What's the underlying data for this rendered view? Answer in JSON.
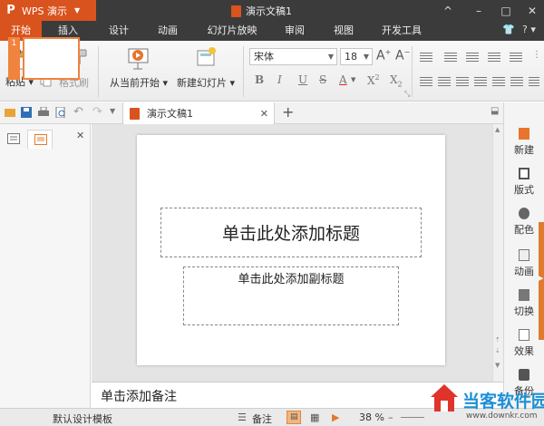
{
  "titlebar": {
    "app_logo": "P",
    "app_name": "WPS 演示",
    "doc_title": "演示文稿1",
    "controls": [
      "^",
      "–",
      "□",
      "✕"
    ]
  },
  "menu": {
    "tabs": [
      "开始",
      "插入",
      "设计",
      "动画",
      "幻灯片放映",
      "审阅",
      "视图",
      "开发工具"
    ],
    "active_tab": "开始",
    "help": "?"
  },
  "ribbon": {
    "paste": "粘贴",
    "format_painter": "格式刷",
    "from_current": "从当前开始",
    "new_slide": "新建幻灯片",
    "font_name": "宋体",
    "font_size": "18",
    "fmt_bold": "B",
    "fmt_italic": "I",
    "fmt_underline": "U",
    "fmt_strike": "S",
    "fmt_color": "A",
    "fmt_super": "X",
    "fmt_sub": "X"
  },
  "quickaccess": {
    "doc_tab_title": "演示文稿1",
    "add_tab": "+"
  },
  "slide": {
    "title_placeholder": "单击此处添加标题",
    "subtitle_placeholder": "单击此处添加副标题",
    "thumb_number": "1"
  },
  "notes": {
    "placeholder": "单击添加备注"
  },
  "rightpane": {
    "items": [
      "新建",
      "版式",
      "配色",
      "动画",
      "切换",
      "效果",
      "备份"
    ]
  },
  "statusbar": {
    "template": "默认设计模板",
    "notes_label": "备注",
    "zoom": "38 %"
  },
  "watermark": {
    "name": "当客软件园",
    "url": "www.downkr.com"
  }
}
